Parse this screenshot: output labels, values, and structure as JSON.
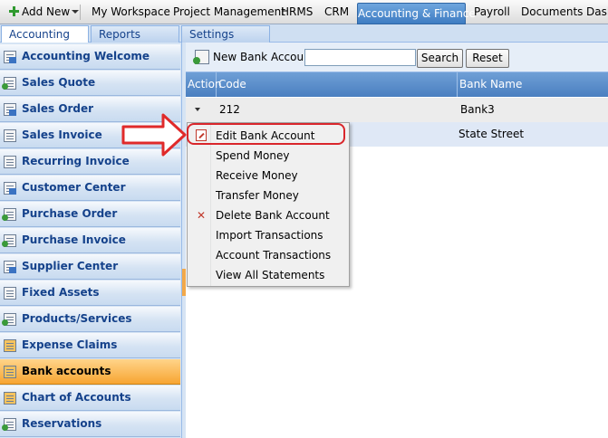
{
  "topnav": {
    "add_new": "Add New",
    "items": [
      "My Workspace",
      "Project Management",
      "HRMS",
      "CRM",
      "Accounting & Finance",
      "Payroll",
      "Documents",
      "Dash"
    ],
    "active": "Accounting & Finance",
    "accent": "#3e7cc2"
  },
  "tabs": [
    "Accounting",
    "Reports",
    "Settings"
  ],
  "sidebar": {
    "items": [
      {
        "label": "Accounting Welcome",
        "icon": "ledger-icon"
      },
      {
        "label": "Sales Quote",
        "icon": "quote-icon"
      },
      {
        "label": "Sales Order",
        "icon": "order-icon"
      },
      {
        "label": "Sales Invoice",
        "icon": "invoice-icon"
      },
      {
        "label": "Recurring Invoice",
        "icon": "recurring-invoice-icon"
      },
      {
        "label": "Customer Center",
        "icon": "customer-icon"
      },
      {
        "label": "Purchase Order",
        "icon": "purchase-order-icon"
      },
      {
        "label": "Purchase Invoice",
        "icon": "purchase-invoice-icon"
      },
      {
        "label": "Supplier Center",
        "icon": "supplier-icon"
      },
      {
        "label": "Fixed Assets",
        "icon": "assets-icon"
      },
      {
        "label": "Products/Services",
        "icon": "products-icon"
      },
      {
        "label": "Expense Claims",
        "icon": "expense-icon"
      },
      {
        "label": "Bank accounts",
        "icon": "bank-icon"
      },
      {
        "label": "Chart of Accounts",
        "icon": "chart-accounts-icon"
      },
      {
        "label": "Reservations",
        "icon": "reservations-icon"
      }
    ],
    "active": "Bank accounts",
    "active_color": "#f7a532"
  },
  "toolbar": {
    "new_label": "New Bank Account",
    "search_value": "",
    "search_button": "Search",
    "reset_button": "Reset"
  },
  "grid": {
    "columns": [
      "Action",
      "Code",
      "Bank Name"
    ],
    "rows": [
      {
        "code": "212",
        "bank": "Bank3"
      },
      {
        "code": "",
        "bank": "State Street"
      }
    ]
  },
  "context_menu": {
    "items": [
      {
        "label": "Edit Bank Account",
        "icon": "edit-icon"
      },
      {
        "label": "Spend Money"
      },
      {
        "label": "Receive Money"
      },
      {
        "label": "Transfer Money"
      },
      {
        "label": "Delete Bank Account",
        "icon": "delete-icon"
      },
      {
        "label": "Import Transactions"
      },
      {
        "label": "Account Transactions"
      },
      {
        "label": "View All Statements"
      }
    ],
    "highlight_color": "#d9262b"
  }
}
